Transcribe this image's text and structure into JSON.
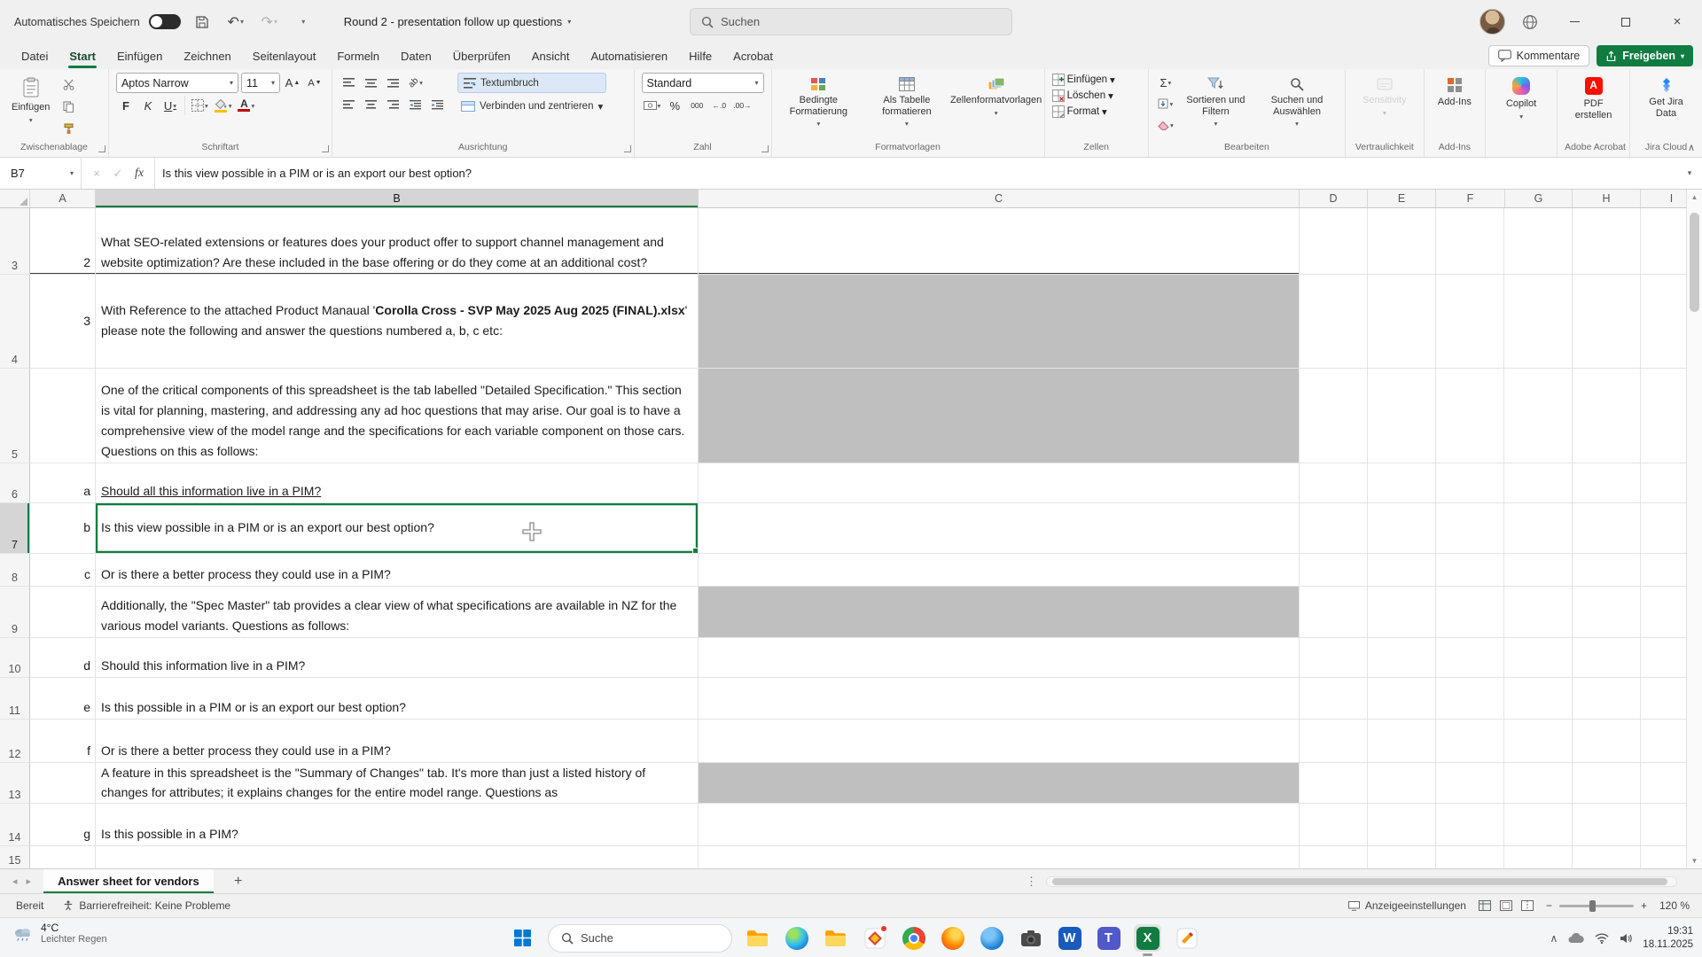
{
  "titlebar": {
    "autosave_label": "Automatisches Speichern",
    "document_title": "Round 2 - presentation follow up questions",
    "search_placeholder": "Suchen"
  },
  "menubar": {
    "tabs": [
      "Datei",
      "Start",
      "Einfügen",
      "Zeichnen",
      "Seitenlayout",
      "Formeln",
      "Daten",
      "Überprüfen",
      "Ansicht",
      "Automatisieren",
      "Hilfe",
      "Acrobat"
    ],
    "comments_label": "Kommentare",
    "share_label": "Freigeben"
  },
  "ribbon": {
    "paste": "Einfügen",
    "font_name": "Aptos Narrow",
    "font_size": "11",
    "bold": "F",
    "italic": "K",
    "underline": "U",
    "wrap_text": "Textumbruch",
    "merge_center": "Verbinden und zentrieren",
    "number_format": "Standard",
    "conditional": "Bedingte Formatierung",
    "format_table": "Als Tabelle formatieren",
    "cell_styles": "Zellenformatvorlagen",
    "insert": "Einfügen",
    "delete": "Löschen",
    "format": "Format",
    "sort_filter": "Sortieren und Filtern",
    "find_select": "Suchen und Auswählen",
    "sensitivity": "Sensitivity",
    "add_ins": "Add-Ins",
    "copilot": "Copilot",
    "create_pdf": "PDF erstellen",
    "get_jira": "Get Jira Data",
    "groups": {
      "clipboard": "Zwischenablage",
      "font": "Schriftart",
      "alignment": "Ausrichtung",
      "number": "Zahl",
      "styles": "Formatvorlagen",
      "cells": "Zellen",
      "editing": "Bearbeiten",
      "sensitivity": "Vertraulichkeit",
      "addins": "Add-Ins",
      "acrobat": "Adobe Acrobat",
      "jira": "Jira Cloud"
    }
  },
  "formula_bar": {
    "name_box": "B7",
    "content": "Is this view possible in a PIM or is an export our best option?"
  },
  "grid": {
    "columns": [
      "A",
      "B",
      "C",
      "D",
      "E",
      "F",
      "G",
      "H",
      "I"
    ],
    "rows": [
      {
        "n": "3",
        "a": "2",
        "b": "What SEO-related extensions or features does your product offer to support channel management and website optimization? Are these included in the base offering or do they come at an additional cost?"
      },
      {
        "n": "4",
        "a": "3",
        "b_pre": "With Reference to the attached Product Manaual '",
        "b_bold": "Corolla Cross - SVP May 2025 Aug 2025 (FINAL).xlsx",
        "b_post": "' please note the following and answer the questions numbered a, b, c etc:"
      },
      {
        "n": "5",
        "b": "One of the critical components of this spreadsheet is the tab labelled \"Detailed Specification.\" This section is vital for planning, mastering, and addressing any ad hoc questions that may arise. Our goal is to have a comprehensive view of the model range and the specifications for each variable component on those cars. Questions on this as follows:"
      },
      {
        "n": "6",
        "a": "a",
        "b": "Should all this information live in a PIM?"
      },
      {
        "n": "7",
        "a": "b",
        "b": "Is this view possible in a PIM or is an export our best option?"
      },
      {
        "n": "8",
        "a": "c",
        "b": "Or is there a better process they could use in a PIM?"
      },
      {
        "n": "9",
        "b": "Additionally, the \"Spec Master\" tab provides a clear view of what specifications are available in NZ for the various model variants. Questions as follows:"
      },
      {
        "n": "10",
        "a": "d",
        "b": "Should this information live in a PIM?"
      },
      {
        "n": "11",
        "a": "e",
        "b": "Is this possible in a PIM or is an export our best option?"
      },
      {
        "n": "12",
        "a": "f",
        "b": "Or is there a better process they could use in a PIM?"
      },
      {
        "n": "13",
        "b": "A feature in this spreadsheet is the \"Summary of Changes\" tab. It's more than just a listed history of changes for attributes; it explains changes for the entire model range. Questions as"
      },
      {
        "n": "14",
        "a": "g",
        "b": "Is this possible in a PIM?"
      },
      {
        "n": "15"
      }
    ]
  },
  "sheet_tabs": {
    "active_tab": "Answer sheet for vendors"
  },
  "status_bar": {
    "mode": "Bereit",
    "accessibility": "Barrierefreiheit: Keine Probleme",
    "display_settings": "Anzeigeeinstellungen",
    "zoom_level": "120 %"
  },
  "taskbar": {
    "weather_temp": "4°C",
    "weather_desc": "Leichter Regen",
    "search_label": "Suche",
    "clock_time": "19:31",
    "clock_date": "18.11.2025"
  },
  "colors": {
    "excel_green": "#107C41",
    "gray_fill": "#BFBFBF"
  }
}
